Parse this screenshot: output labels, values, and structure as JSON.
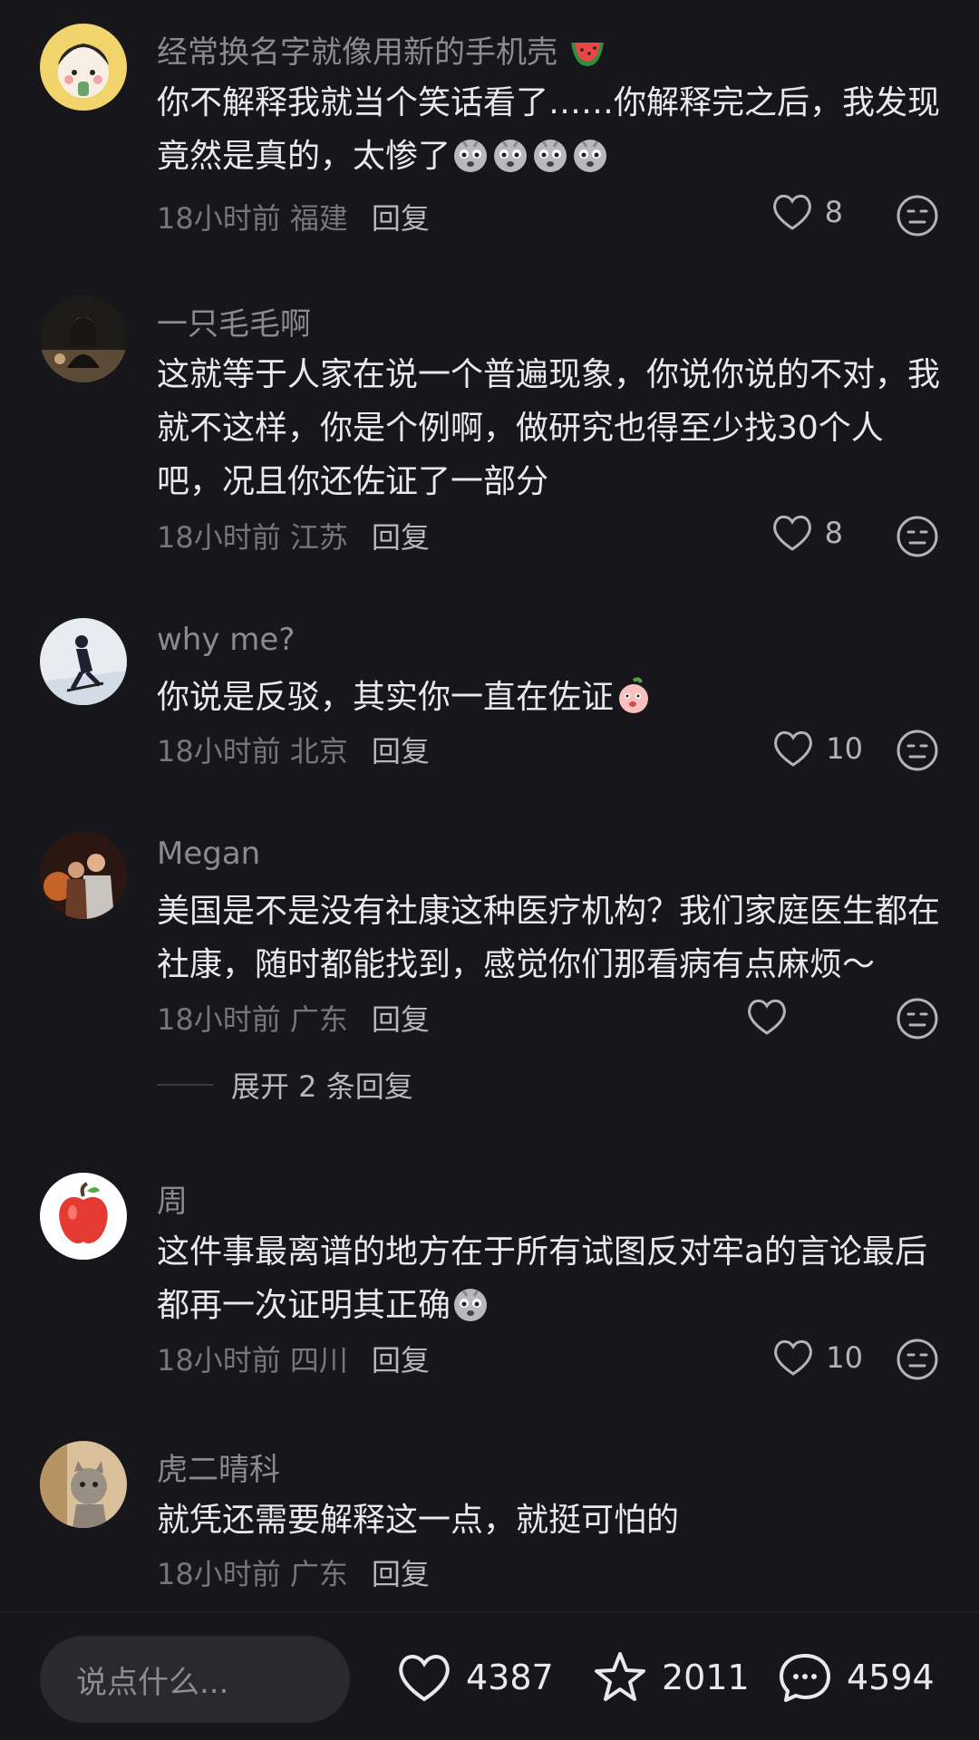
{
  "comments": [
    {
      "username": "经常换名字就像用新的手机壳",
      "text": "你不解释我就当个笑话看了……你解释完之后，我发现竟然是真的，太惨了",
      "time": "18小时前",
      "location": "福建",
      "reply": "回复",
      "likes": "8"
    },
    {
      "username": "一只毛毛啊",
      "text": "这就等于人家在说一个普遍现象，你说你说的不对，我就不这样，你是个例啊，做研究也得至少找30个人吧，况且你还佐证了一部分",
      "time": "18小时前",
      "location": "江苏",
      "reply": "回复",
      "likes": "8"
    },
    {
      "username": "why me?",
      "text": "你说是反驳，其实你一直在佐证",
      "time": "18小时前",
      "location": "北京",
      "reply": "回复",
      "likes": "10"
    },
    {
      "username": "Megan",
      "text": "美国是不是没有社康这种医疗机构？我们家庭医生都在社康，随时都能找到，感觉你们那看病有点麻烦～",
      "time": "18小时前",
      "location": "广东",
      "reply": "回复",
      "likes": "",
      "expand": "展开 2 条回复"
    },
    {
      "username": "周",
      "text": "这件事最离谱的地方在于所有试图反对牢a的言论最后都再一次证明其正确",
      "time": "18小时前",
      "location": "四川",
      "reply": "回复",
      "likes": "10"
    },
    {
      "username": "虎二晴科",
      "text": "就凭还需要解释这一点，就挺可怕的",
      "time": "18小时前",
      "location": "广东",
      "reply": "回复",
      "likes": ""
    }
  ],
  "bottom_bar": {
    "input_placeholder": "说点什么...",
    "like_count": "4387",
    "star_count": "2011",
    "comment_count": "4594"
  },
  "icons": [
    "heart-icon",
    "neutral-face-icon",
    "star-icon",
    "comment-bubble-icon"
  ],
  "colors": {
    "background": "#17161b",
    "text": "#e9e8ec",
    "muted": "#8b8a90"
  }
}
